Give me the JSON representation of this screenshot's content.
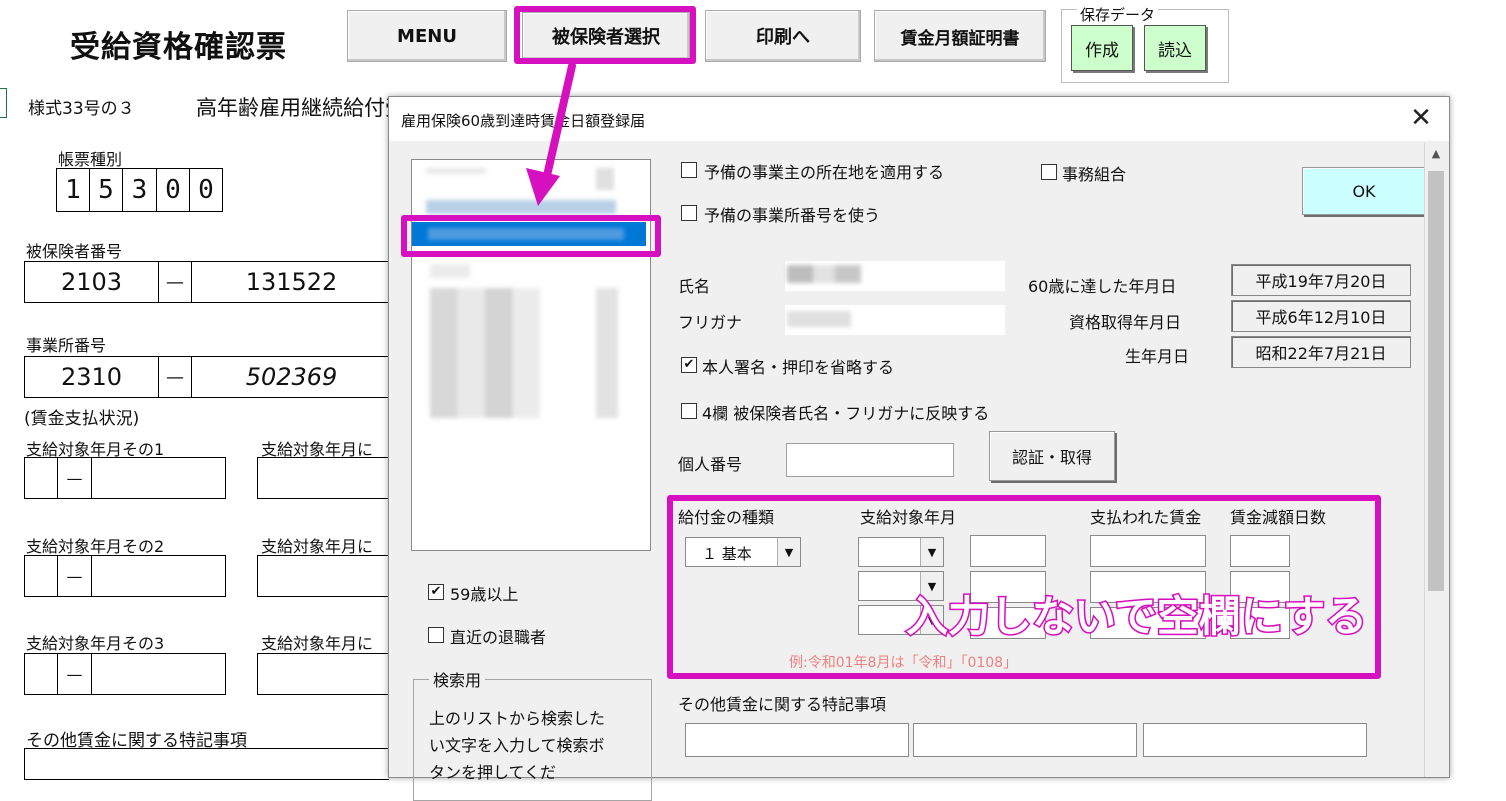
{
  "sheet": {
    "title": "受給資格確認票",
    "form_no": "様式33号の３",
    "form_name": "高年齢雇用継続給付受給資格確認票",
    "voucher_type_label": "帳票種別",
    "voucher_digits": [
      "1",
      "5",
      "3",
      "0",
      "0"
    ],
    "insured_no_label": "被保険者番号",
    "insured_no": [
      "2103",
      "—",
      "131522"
    ],
    "office_no_label": "事業所番号",
    "office_no": [
      "2310",
      "—",
      "502369"
    ],
    "wage_status_label": "(賃金支払状況)",
    "pay_month_1": "支給対象年月その1",
    "pay_month_2": "支給対象年月その2",
    "pay_month_3": "支給対象年月その3",
    "pay_month_col2": "支給対象年月に",
    "dash": "—",
    "other_wage_label": "その他賃金に関する特記事項"
  },
  "toolbar": {
    "menu": "MENU",
    "select_insured": "被保険者選択",
    "to_print": "印刷へ",
    "wage_cert": "賃金月額証明書",
    "save_data_label": "保存データ",
    "create": "作成",
    "load": "読込"
  },
  "dialog": {
    "title": "雇用保険60歳到達時賃金日額登録届",
    "close": "✕",
    "use_spare_address": "予備の事業主の所在地を適用する",
    "office_union": "事務組合",
    "use_spare_office_no": "予備の事業所番号を使う",
    "ok": "OK",
    "name_label": "氏名",
    "name_value": "",
    "furigana_label": "フリガナ",
    "reached_60_label": "60歳に達した年月日",
    "reached_60_value": "平成19年7月20日",
    "qualified_label": "資格取得年月日",
    "qualified_value": "平成6年12月10日",
    "birth_label": "生年月日",
    "birth_value": "昭和22年7月21日",
    "omit_seal": "本人署名・押印を省略する",
    "omit_seal_checked": true,
    "reflect_name": "4欄 被保険者氏名・フリガナに反映する",
    "my_number_label": "個人番号",
    "auth_button": "認証・取得",
    "benefit_type_label": "給付金の種類",
    "benefit_type_value": "１ 基本",
    "pay_target_label": "支給対象年月",
    "paid_wage_label": "支払われた賃金",
    "reduced_days_label": "賃金減額日数",
    "example_hint": "例:令和01年8月は「令和」「0108」",
    "over59": "59歳以上",
    "over59_checked": true,
    "recent_retiree": "直近の退職者",
    "search_group": "検索用",
    "search_help": "上のリストから検索したい文字を入力して検索ボタンを押してくだ",
    "other_wage_label": "その他賃金に関する特記事項"
  },
  "annotation": {
    "overlay_text": "入力しないで空欄にする",
    "accent": "#d60fbf"
  },
  "colors": {
    "ok_button": "#ccffff",
    "green_button": "#ccffcc",
    "list_selection": "#0078d7"
  }
}
